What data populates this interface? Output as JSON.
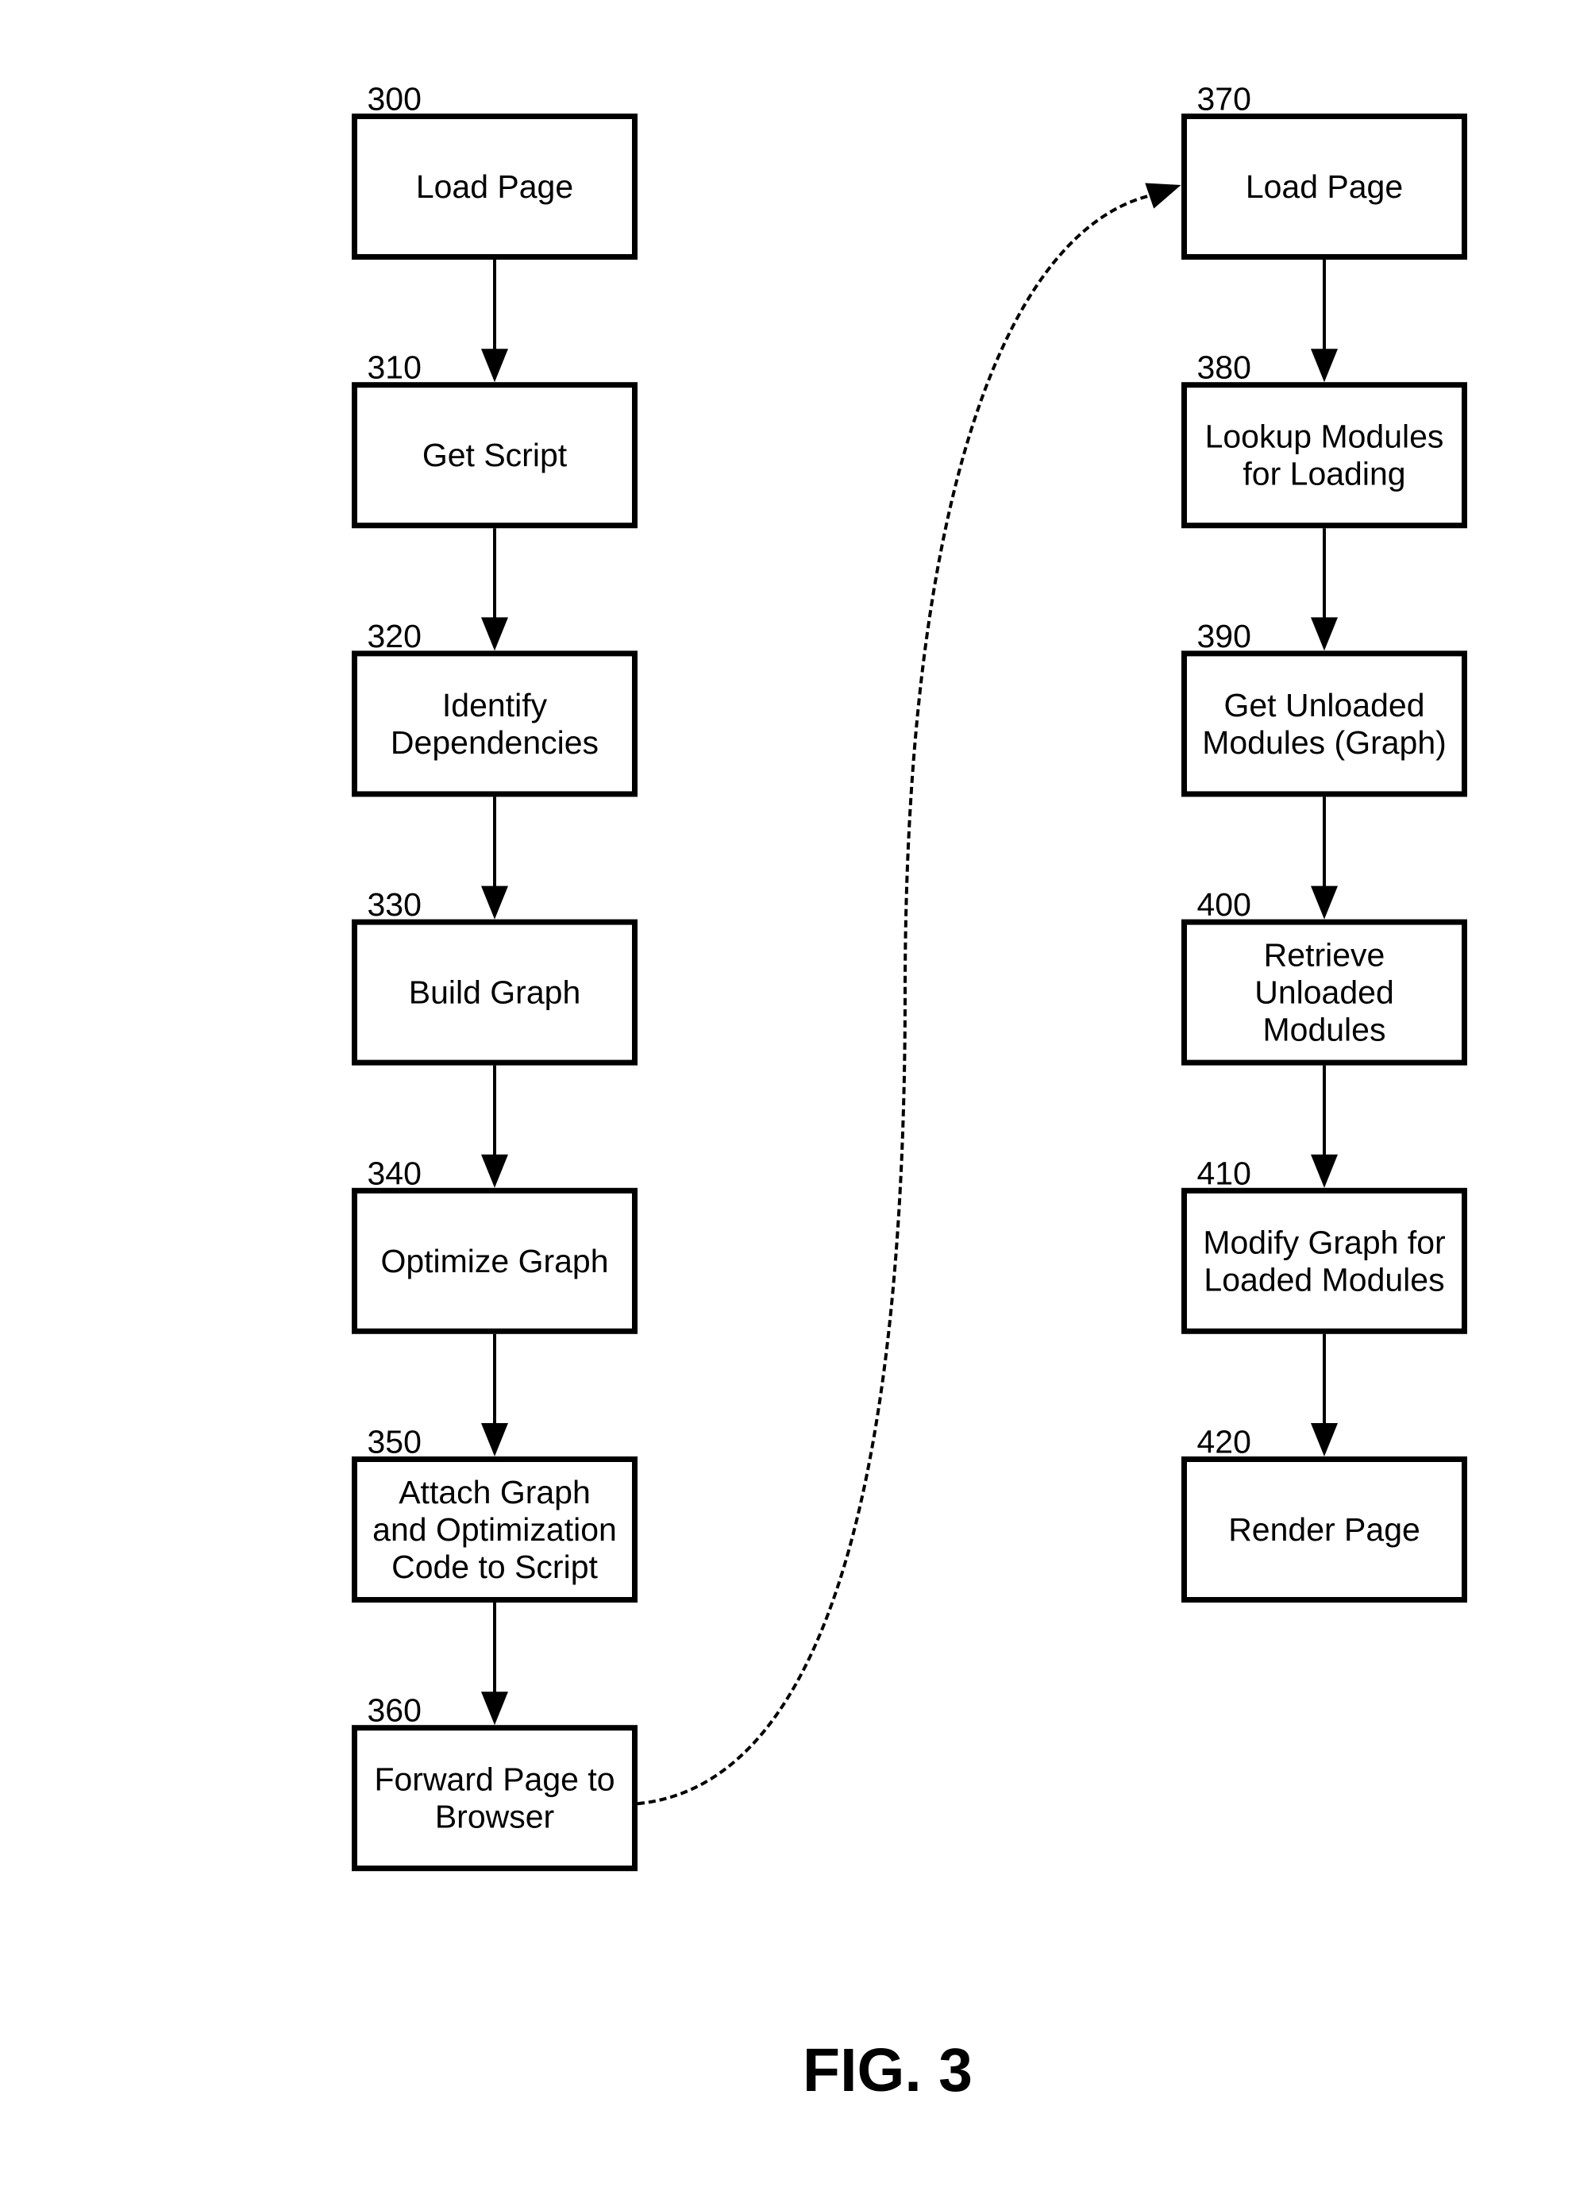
{
  "figure": {
    "caption": "FIG. 3"
  },
  "columns": [
    {
      "id": "server",
      "steps": [
        {
          "ref": "300",
          "lines": [
            "Load Page"
          ]
        },
        {
          "ref": "310",
          "lines": [
            "Get Script"
          ]
        },
        {
          "ref": "320",
          "lines": [
            "Identify",
            "Dependencies"
          ]
        },
        {
          "ref": "330",
          "lines": [
            "Build Graph"
          ]
        },
        {
          "ref": "340",
          "lines": [
            "Optimize Graph"
          ]
        },
        {
          "ref": "350",
          "lines": [
            "Attach Graph",
            "and Optimization",
            "Code to Script"
          ]
        },
        {
          "ref": "360",
          "lines": [
            "Forward Page to",
            "Browser"
          ]
        }
      ]
    },
    {
      "id": "browser",
      "steps": [
        {
          "ref": "370",
          "lines": [
            "Load Page"
          ]
        },
        {
          "ref": "380",
          "lines": [
            "Lookup Modules",
            "for Loading"
          ]
        },
        {
          "ref": "390",
          "lines": [
            "Get Unloaded",
            "Modules (Graph)"
          ]
        },
        {
          "ref": "400",
          "lines": [
            "Retrieve",
            "Unloaded",
            "Modules"
          ]
        },
        {
          "ref": "410",
          "lines": [
            "Modify Graph for",
            "Loaded Modules"
          ]
        },
        {
          "ref": "420",
          "lines": [
            "Render Page"
          ]
        }
      ]
    }
  ],
  "connections": [
    {
      "from": "300",
      "to": "310",
      "style": "solid"
    },
    {
      "from": "310",
      "to": "320",
      "style": "solid"
    },
    {
      "from": "320",
      "to": "330",
      "style": "solid"
    },
    {
      "from": "330",
      "to": "340",
      "style": "solid"
    },
    {
      "from": "340",
      "to": "350",
      "style": "solid"
    },
    {
      "from": "350",
      "to": "360",
      "style": "solid"
    },
    {
      "from": "360",
      "to": "370",
      "style": "dashed-curve"
    },
    {
      "from": "370",
      "to": "380",
      "style": "solid"
    },
    {
      "from": "380",
      "to": "390",
      "style": "solid"
    },
    {
      "from": "390",
      "to": "400",
      "style": "solid"
    },
    {
      "from": "400",
      "to": "410",
      "style": "solid"
    },
    {
      "from": "410",
      "to": "420",
      "style": "solid"
    }
  ]
}
